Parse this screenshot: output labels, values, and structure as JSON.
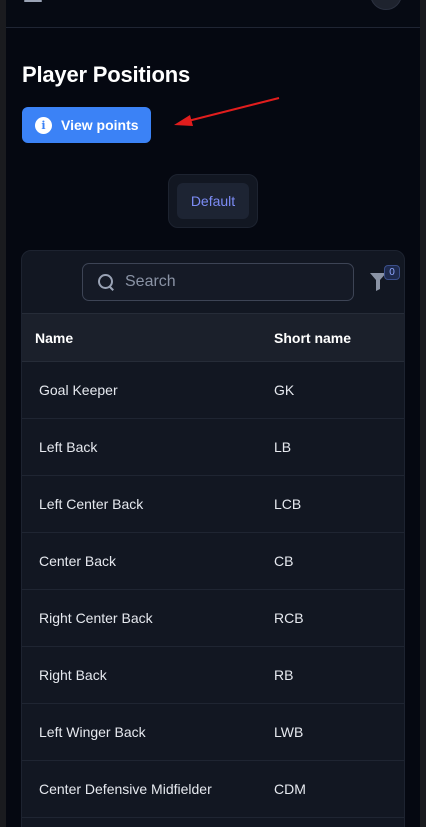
{
  "page": {
    "title": "Player Positions"
  },
  "actions": {
    "view_points_label": "View points"
  },
  "segments": {
    "default_label": "Default"
  },
  "search": {
    "placeholder": "Search"
  },
  "filter": {
    "count": "0"
  },
  "table": {
    "columns": {
      "name": "Name",
      "short_name": "Short name"
    },
    "rows": [
      {
        "name": "Goal Keeper",
        "short": "GK"
      },
      {
        "name": "Left Back",
        "short": "LB"
      },
      {
        "name": "Left Center Back",
        "short": "LCB"
      },
      {
        "name": "Center Back",
        "short": "CB"
      },
      {
        "name": "Right Center Back",
        "short": "RCB"
      },
      {
        "name": "Right Back",
        "short": "RB"
      },
      {
        "name": "Left Winger Back",
        "short": "LWB"
      },
      {
        "name": "Center Defensive Midfielder",
        "short": "CDM"
      }
    ]
  },
  "colors": {
    "accent": "#3b82f6",
    "background": "#050811",
    "annotation_arrow": "#e11d1d",
    "segment_text": "#7c8cf5"
  },
  "icons": {
    "menu": "hamburger-icon",
    "info": "info-icon",
    "search": "search-icon",
    "filter": "filter-icon"
  }
}
